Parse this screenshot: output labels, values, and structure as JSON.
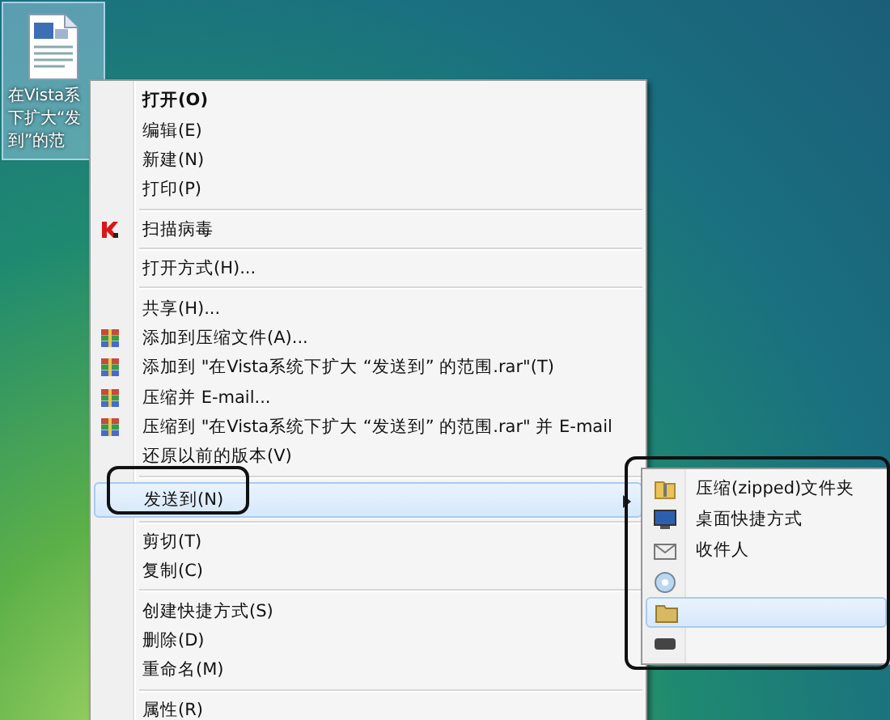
{
  "desktop_icon": {
    "label_lines": [
      "在Vista系",
      "下扩大“发",
      "到”的范"
    ],
    "selected": true
  },
  "context_menu": {
    "groups": [
      [
        {
          "label": "打开(O)",
          "kind": "plain",
          "bold": true,
          "selected": false,
          "submenu": false
        },
        {
          "label": "编辑(E)",
          "kind": "plain",
          "bold": false,
          "selected": false,
          "submenu": false
        },
        {
          "label": "新建(N)",
          "kind": "plain",
          "bold": false,
          "selected": false,
          "submenu": false
        },
        {
          "label": "打印(P)",
          "kind": "plain",
          "bold": false,
          "selected": false,
          "submenu": false
        }
      ],
      [
        {
          "label": "扫描病毒",
          "kind": "antivirus",
          "bold": false,
          "selected": false,
          "submenu": false
        }
      ],
      [
        {
          "label": "打开方式(H)...",
          "kind": "plain",
          "bold": false,
          "selected": false,
          "submenu": false
        }
      ],
      [
        {
          "label": "共享(H)...",
          "kind": "plain",
          "bold": false,
          "selected": false,
          "submenu": false
        },
        {
          "label": "添加到压缩文件(A)...",
          "kind": "archive",
          "bold": false,
          "selected": false,
          "submenu": false
        },
        {
          "label": "添加到 \"在Vista系统下扩大 “发送到” 的范围.rar\"(T)",
          "kind": "archive",
          "bold": false,
          "selected": false,
          "submenu": false
        },
        {
          "label": "压缩并 E-mail...",
          "kind": "archive",
          "bold": false,
          "selected": false,
          "submenu": false
        },
        {
          "label": "压缩到 \"在Vista系统下扩大 “发送到” 的范围.rar\" 并 E-mail",
          "kind": "archive",
          "bold": false,
          "selected": false,
          "submenu": false
        },
        {
          "label": "还原以前的版本(V)",
          "kind": "plain",
          "bold": false,
          "selected": false,
          "submenu": false
        }
      ],
      [
        {
          "label": "发送到(N)",
          "kind": "plain",
          "bold": false,
          "selected": true,
          "submenu": true
        }
      ],
      [
        {
          "label": "剪切(T)",
          "kind": "plain",
          "bold": false,
          "selected": false,
          "submenu": false
        },
        {
          "label": "复制(C)",
          "kind": "plain",
          "bold": false,
          "selected": false,
          "submenu": false
        }
      ],
      [
        {
          "label": "创建快捷方式(S)",
          "kind": "plain",
          "bold": false,
          "selected": false,
          "submenu": false
        },
        {
          "label": "删除(D)",
          "kind": "plain",
          "bold": false,
          "selected": false,
          "submenu": false
        },
        {
          "label": "重命名(M)",
          "kind": "plain",
          "bold": false,
          "selected": false,
          "submenu": false
        }
      ],
      [
        {
          "label": "属性(R)",
          "kind": "plain",
          "bold": false,
          "selected": false,
          "submenu": false
        }
      ]
    ]
  },
  "send_to_menu": {
    "items": [
      {
        "label": "压缩(zipped)文件夹",
        "kind": "zip-folder",
        "selected": false
      },
      {
        "label": "桌面快捷方式",
        "kind": "desktop",
        "selected": false
      },
      {
        "label": "收件人",
        "kind": "mail",
        "selected": false
      },
      {
        "kind": "disc",
        "selected": false
      },
      {
        "kind": "folder",
        "selected": true
      },
      {
        "kind": "drive",
        "selected": false
      }
    ]
  }
}
